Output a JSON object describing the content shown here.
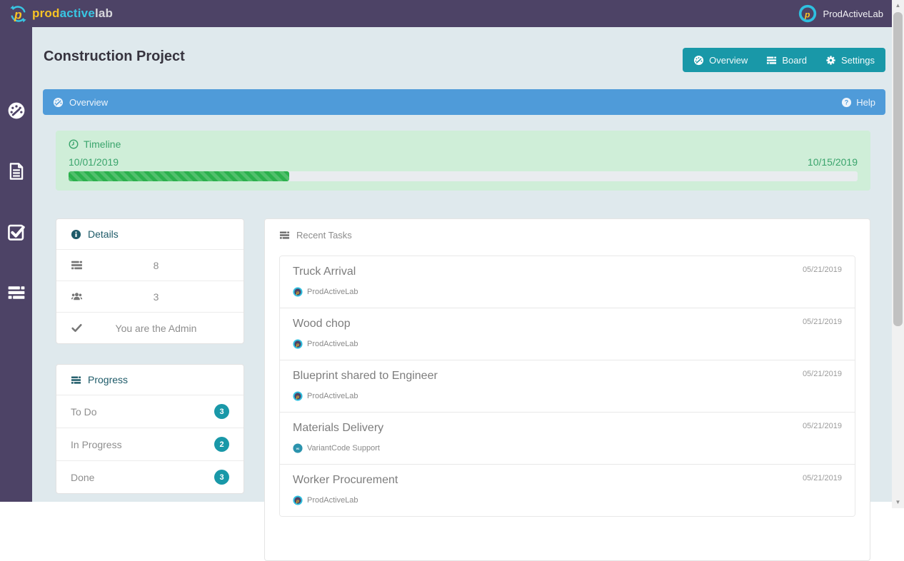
{
  "topbar": {
    "brand": {
      "part1": "prod",
      "part2": "active",
      "part3": "lab"
    },
    "user_name": "ProdActiveLab"
  },
  "sidebar": {
    "items": [
      {
        "id": "dashboard",
        "icon": "dashboard"
      },
      {
        "id": "documents",
        "icon": "document"
      },
      {
        "id": "tasks",
        "icon": "check-square"
      },
      {
        "id": "board",
        "icon": "stream"
      }
    ]
  },
  "project": {
    "title": "Construction Project",
    "nav": [
      {
        "label": "Overview",
        "icon": "dashboard"
      },
      {
        "label": "Board",
        "icon": "stream"
      },
      {
        "label": "Settings",
        "icon": "gear"
      }
    ]
  },
  "overview_bar": {
    "label": "Overview",
    "help_label": "Help"
  },
  "timeline": {
    "label": "Timeline",
    "start_date": "10/01/2019",
    "end_date": "10/15/2019",
    "progress_percent": 28
  },
  "details": {
    "title": "Details",
    "rows": [
      {
        "icon": "stream",
        "value": "8"
      },
      {
        "icon": "users",
        "value": "3"
      },
      {
        "icon": "check",
        "value": "You are the Admin"
      }
    ]
  },
  "progress": {
    "title": "Progress",
    "rows": [
      {
        "label": "To Do",
        "count": "3"
      },
      {
        "label": "In Progress",
        "count": "2"
      },
      {
        "label": "Done",
        "count": "3"
      }
    ]
  },
  "recent_tasks": {
    "title": "Recent Tasks",
    "tasks": [
      {
        "title": "Truck Arrival",
        "assignee": "ProdActiveLab",
        "avatar": "prodactivelab",
        "date": "05/21/2019"
      },
      {
        "title": "Wood chop",
        "assignee": "ProdActiveLab",
        "avatar": "prodactivelab",
        "date": "05/21/2019"
      },
      {
        "title": "Blueprint shared to Engineer",
        "assignee": "ProdActiveLab",
        "avatar": "prodactivelab",
        "date": "05/21/2019"
      },
      {
        "title": "Materials Delivery",
        "assignee": "VariantCode Support",
        "avatar": "variantcode",
        "date": "05/21/2019"
      },
      {
        "title": "Worker Procurement",
        "assignee": "ProdActiveLab",
        "avatar": "prodactivelab",
        "date": "05/21/2019"
      }
    ]
  },
  "colors": {
    "brand_purple": "#4d4366",
    "teal": "#1998a8",
    "blue_bar": "#4f9bd9",
    "timeline_bg": "#cfeed8",
    "timeline_text": "#3aa46c",
    "progress_fill": "#2bb14c",
    "brand_yellow": "#f7c325",
    "brand_cyan": "#38c6e3"
  }
}
